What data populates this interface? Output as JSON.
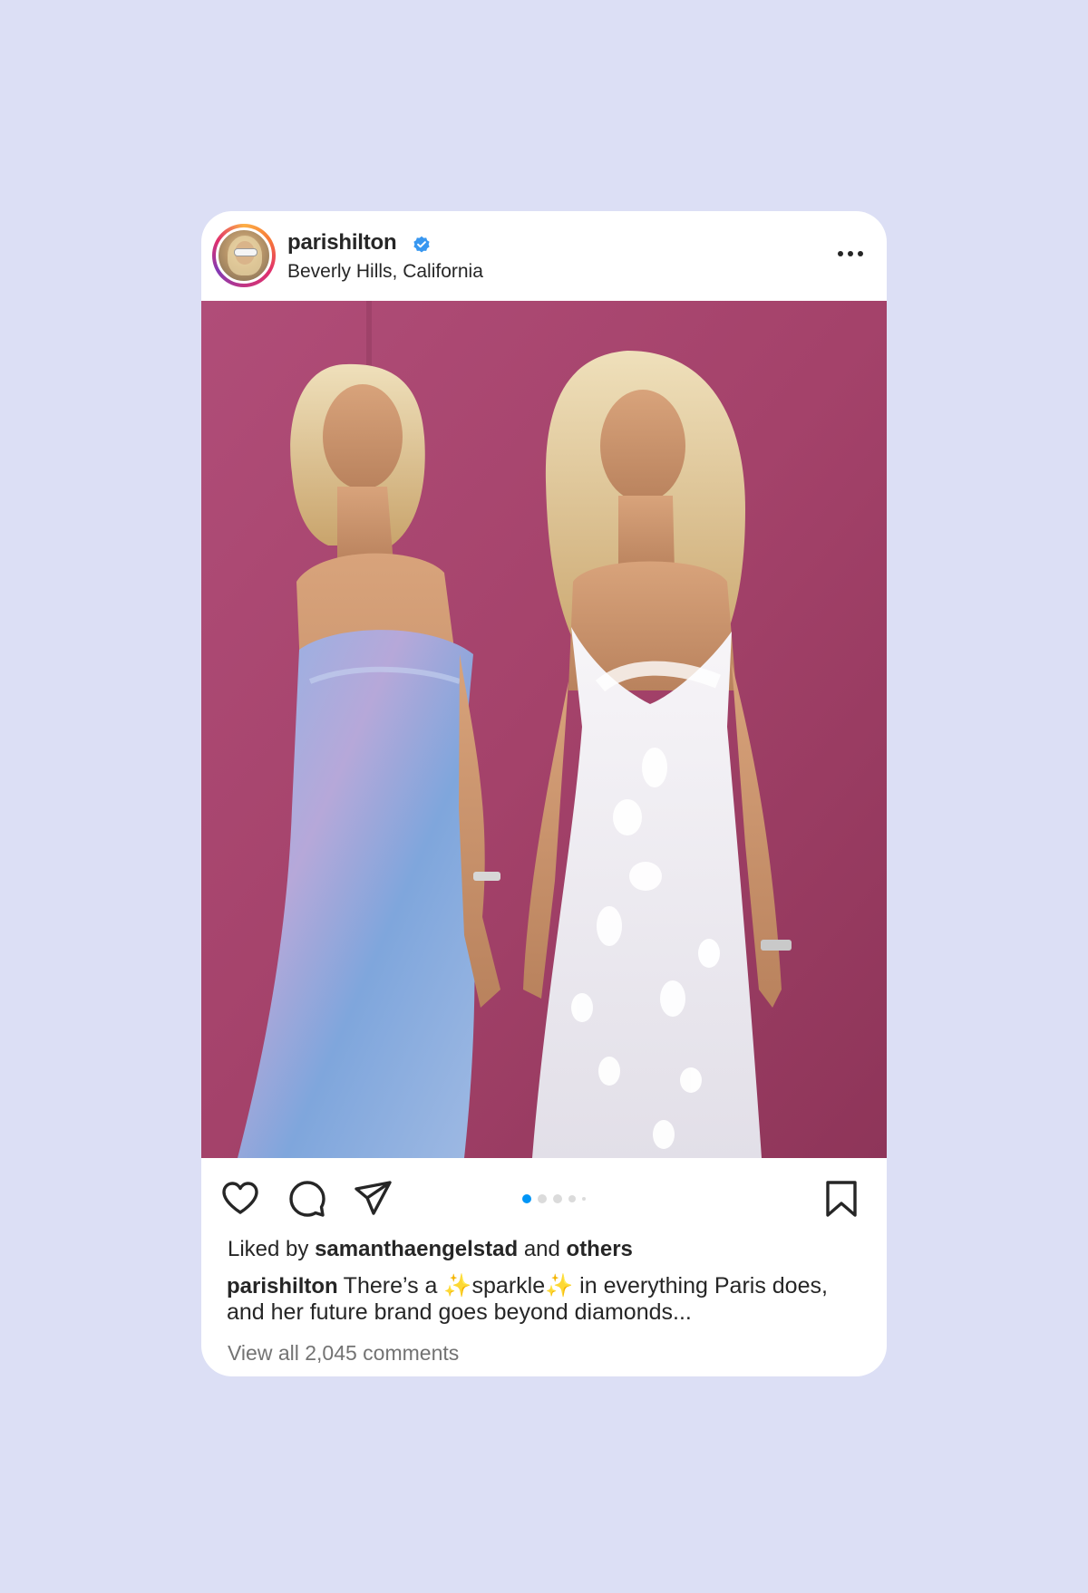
{
  "post": {
    "username": "parishilton",
    "verified": true,
    "location": "Beverly Hills, California",
    "more_icon": "more-horizontal-icon",
    "image_alt": "Two women in evening dresses against a pink wall"
  },
  "actions": {
    "like_icon": "heart-icon",
    "comment_icon": "comment-icon",
    "share_icon": "send-icon",
    "save_icon": "bookmark-icon",
    "carousel_pages": 5,
    "carousel_active": 1
  },
  "likes": {
    "prefix": "Liked by",
    "user": "samanthaengelstad",
    "joiner": "and",
    "suffix": "others"
  },
  "caption": {
    "user": "parishilton",
    "text": "There’s a ✨sparkle✨ in everything Paris does, and her future brand goes beyond diamonds..."
  },
  "comments": {
    "label": "View all 2,045 comments"
  },
  "colors": {
    "background": "#dcdff5",
    "verified_blue": "#3897f0",
    "active_dot": "#0095f6",
    "wall_pink": "#a8466e"
  }
}
